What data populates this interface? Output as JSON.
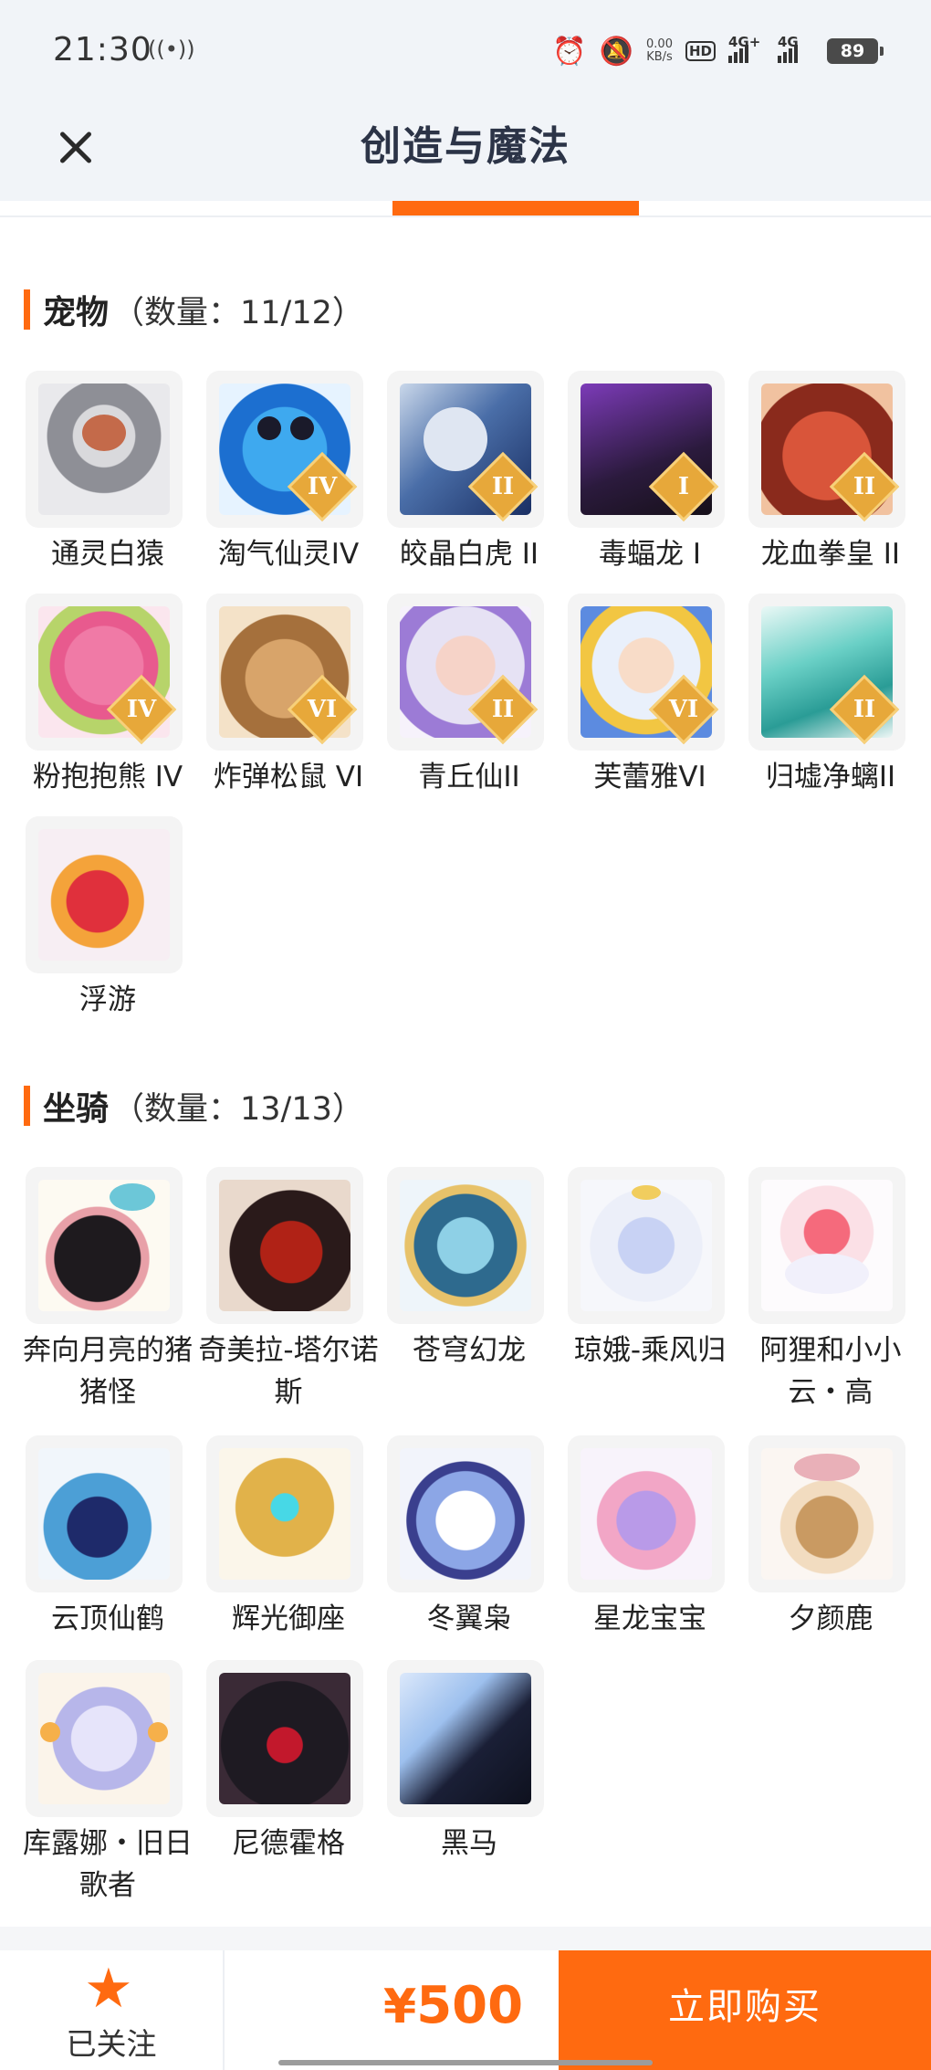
{
  "status_bar": {
    "time": "21:30",
    "vibrate_icon": "vibrate-icon",
    "net_speed_value": "0.00",
    "net_speed_unit": "KB/s",
    "hd_label": "HD",
    "sim1_label": "4G+",
    "sim2_label": "4G",
    "battery": "89"
  },
  "header": {
    "close_icon": "close-icon",
    "title": "创造与魔法"
  },
  "sections": {
    "pets": {
      "name": "宠物",
      "count": "（数量：11/12）",
      "items": [
        {
          "name": "通灵白猿",
          "badge": ""
        },
        {
          "name": "淘气仙灵IV",
          "badge": "IV"
        },
        {
          "name": "皎晶白虎 II",
          "badge": "II"
        },
        {
          "name": "毒蝠龙 I",
          "badge": "I"
        },
        {
          "name": "龙血拳皇 II",
          "badge": "II"
        },
        {
          "name": "粉抱抱熊 IV",
          "badge": "IV"
        },
        {
          "name": "炸弹松鼠 VI",
          "badge": "VI"
        },
        {
          "name": "青丘仙II",
          "badge": "II"
        },
        {
          "name": "芙蕾雅VI",
          "badge": "VI"
        },
        {
          "name": "归墟净螭II",
          "badge": "II"
        },
        {
          "name": "浮游",
          "badge": ""
        }
      ]
    },
    "mounts": {
      "name": "坐骑",
      "count": "（数量：13/13）",
      "items": [
        {
          "name": "奔向月亮的猪猪怪"
        },
        {
          "name": "奇美拉-塔尔诺斯"
        },
        {
          "name": "苍穹幻龙"
        },
        {
          "name": "琼娥-乘风归"
        },
        {
          "name": "阿狸和小小云・高"
        },
        {
          "name": "云顶仙鹤"
        },
        {
          "name": "辉光御座"
        },
        {
          "name": "冬翼枭"
        },
        {
          "name": "星龙宝宝"
        },
        {
          "name": "夕颜鹿"
        },
        {
          "name": "库露娜・旧日歌者"
        },
        {
          "name": "尼德霍格"
        },
        {
          "name": "黑马"
        }
      ]
    }
  },
  "footer": {
    "star_icon": "star-icon",
    "follow_label": "已关注",
    "currency": "¥",
    "price": "500",
    "buy_label": "立即购买"
  },
  "colors": {
    "accent": "#ff6a10",
    "header_bg": "#f1f4f8",
    "badge": "#e7a83a"
  }
}
